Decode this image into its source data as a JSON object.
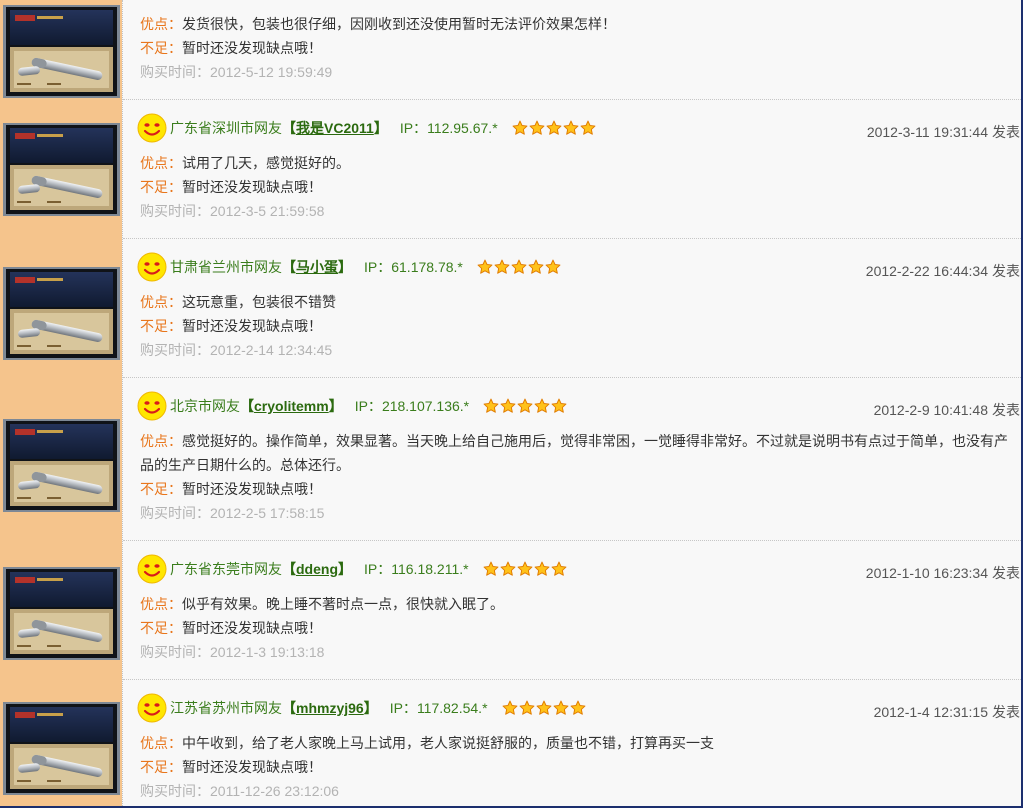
{
  "ui": {
    "pros_label": "优点：",
    "cons_label": "不足：",
    "purchase_label": "购买时间：",
    "ip_label": "IP：",
    "bracket_open": "【",
    "bracket_close": "】",
    "posted_suffix": "发表"
  },
  "icons": {
    "avatar": "smiley-face-icon",
    "rating": "star-icon",
    "thumbnail": "pen-gift-box-thumbnail"
  },
  "colors": {
    "label": "#e8761c",
    "text": "#333333",
    "muted": "#b3b3b3",
    "user": "#3a7d1c",
    "username": "#2b6a0f",
    "date": "#555555",
    "star": "#ffc21a",
    "sidebar_bg": "#f5c48c",
    "panel_bg": "#f8f8f8"
  },
  "reviews": [
    {
      "pros": "发货很快，包装也很仔细，因刚收到还没使用暂时无法评价效果怎样！",
      "cons": "暂时还没发现缺点哦！",
      "purchase_time": "2012-5-12 19:59:49"
    },
    {
      "location": "广东省深圳市网友",
      "username": "我是VC2011",
      "ip": "112.95.67.*",
      "rating": 5,
      "posted_at": "2012-3-11 19:31:44",
      "pros": "试用了几天，感觉挺好的。",
      "cons": "暂时还没发现缺点哦！",
      "purchase_time": "2012-3-5 21:59:58"
    },
    {
      "location": "甘肃省兰州市网友",
      "username": "马小蛋",
      "ip": "61.178.78.*",
      "rating": 5,
      "posted_at": "2012-2-22 16:44:34",
      "pros": "这玩意重，包装很不错赞",
      "cons": "暂时还没发现缺点哦！",
      "purchase_time": "2012-2-14 12:34:45"
    },
    {
      "location": "北京市网友",
      "username": "cryolitemm",
      "ip": "218.107.136.*",
      "rating": 5,
      "posted_at": "2012-2-9 10:41:48",
      "pros": "感觉挺好的。操作简单，效果显著。当天晚上给自己施用后，觉得非常困，一觉睡得非常好。不过就是说明书有点过于简单，也没有产品的生产日期什么的。总体还行。",
      "cons": "暂时还没发现缺点哦！",
      "purchase_time": "2012-2-5 17:58:15"
    },
    {
      "location": "广东省东莞市网友",
      "username": "ddeng",
      "ip": "116.18.211.*",
      "rating": 5,
      "posted_at": "2012-1-10 16:23:34",
      "pros": "似乎有效果。晚上睡不著时点一点，很快就入眠了。",
      "cons": "暂时还没发现缺点哦！",
      "purchase_time": "2012-1-3 19:13:18"
    },
    {
      "location": "江苏省苏州市网友",
      "username": "mhmzyj96",
      "ip": "117.82.54.*",
      "rating": 5,
      "posted_at": "2012-1-4 12:31:15",
      "pros": "中午收到，给了老人家晚上马上试用，老人家说挺舒服的，质量也不错，打算再买一支",
      "cons": "暂时还没发现缺点哦！",
      "purchase_time": "2011-12-26 23:12:06"
    }
  ]
}
